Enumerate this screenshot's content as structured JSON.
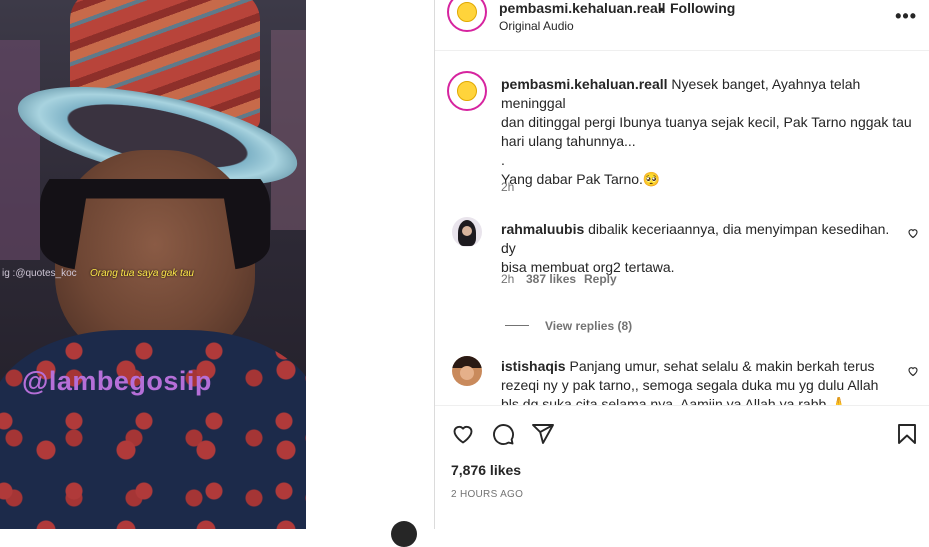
{
  "media": {
    "watermark_small": "ig :@quotes_koc",
    "caption": "Orang tua saya gak tau",
    "watermark_big": "@lambegosiip"
  },
  "header": {
    "username": "pembasmi.kehaluan.reall",
    "separator": "•",
    "follow_label": "Following",
    "subtitle": "Original Audio",
    "more_icon": "more-horizontal-icon"
  },
  "caption_comment": {
    "username": "pembasmi.kehaluan.reall",
    "line1": "Nyesek banget, Ayahnya telah meninggal",
    "line2": "dan ditinggal pergi Ibunya tuanya sejak kecil, Pak Tarno nggak tau",
    "line3": "hari ulang tahunnya...",
    "line4": ".",
    "line5": "Yang dabar Pak Tarno.🥺",
    "age": "2h"
  },
  "comments": [
    {
      "username": "rahmaluubis",
      "line1": "dibalik keceriaannya, dia menyimpan kesedihan. dy",
      "line2": "bisa membuat org2 tertawa.",
      "age": "2h",
      "likes": "387 likes",
      "reply": "Reply",
      "view_replies": "View replies (8)"
    },
    {
      "username": "istishaqis",
      "line1": "Panjang umur, sehat selalu & makin berkah terus",
      "line2": "rezeqi ny y pak tarno,, semoga segala duka mu yg dulu Allah",
      "line3": "bls dg suka cita selama nya. Aamiin ya Allah ya rabb 🙏"
    }
  ],
  "footer": {
    "likes": "7,876 likes",
    "time": "2 HOURS AGO",
    "icons": [
      "heart-icon",
      "comment-icon",
      "share-icon",
      "bookmark-icon"
    ]
  },
  "colors": {
    "text": "#262626",
    "muted": "#737373",
    "divider": "#dbdbdb",
    "ring": "#d6249f",
    "watermark": "#b56fd8",
    "caption_yellow": "#ffe94a"
  }
}
